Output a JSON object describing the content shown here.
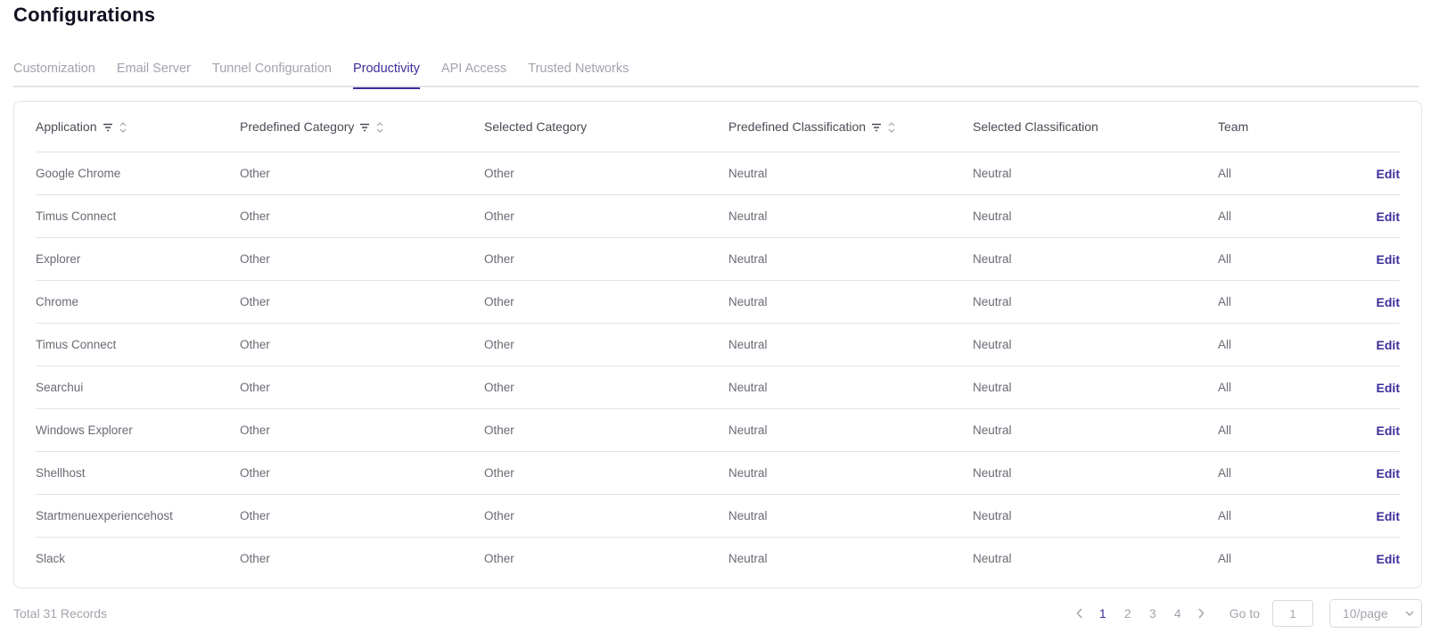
{
  "page_title": "Configurations",
  "tabs": [
    {
      "label": "Customization",
      "active": false
    },
    {
      "label": "Email Server",
      "active": false
    },
    {
      "label": "Tunnel Configuration",
      "active": false
    },
    {
      "label": "Productivity",
      "active": true
    },
    {
      "label": "API Access",
      "active": false
    },
    {
      "label": "Trusted Networks",
      "active": false
    }
  ],
  "table": {
    "columns": [
      {
        "label": "Application",
        "filter": true,
        "sort": true
      },
      {
        "label": "Predefined Category",
        "filter": true,
        "sort": true
      },
      {
        "label": "Selected Category",
        "filter": false,
        "sort": false
      },
      {
        "label": "Predefined Classification",
        "filter": true,
        "sort": true
      },
      {
        "label": "Selected Classification",
        "filter": false,
        "sort": false
      },
      {
        "label": "Team",
        "filter": false,
        "sort": false
      }
    ],
    "action_label": "Edit",
    "rows": [
      [
        "Google Chrome",
        "Other",
        "Other",
        "Neutral",
        "Neutral",
        "All"
      ],
      [
        "Timus Connect",
        "Other",
        "Other",
        "Neutral",
        "Neutral",
        "All"
      ],
      [
        "Explorer",
        "Other",
        "Other",
        "Neutral",
        "Neutral",
        "All"
      ],
      [
        "Chrome",
        "Other",
        "Other",
        "Neutral",
        "Neutral",
        "All"
      ],
      [
        "Timus Connect",
        "Other",
        "Other",
        "Neutral",
        "Neutral",
        "All"
      ],
      [
        "Searchui",
        "Other",
        "Other",
        "Neutral",
        "Neutral",
        "All"
      ],
      [
        "Windows Explorer",
        "Other",
        "Other",
        "Neutral",
        "Neutral",
        "All"
      ],
      [
        "Shellhost",
        "Other",
        "Other",
        "Neutral",
        "Neutral",
        "All"
      ],
      [
        "Startmenuexperiencehost",
        "Other",
        "Other",
        "Neutral",
        "Neutral",
        "All"
      ],
      [
        "Slack",
        "Other",
        "Other",
        "Neutral",
        "Neutral",
        "All"
      ]
    ]
  },
  "footer": {
    "total_text": "Total 31 Records",
    "pages": [
      "1",
      "2",
      "3",
      "4"
    ],
    "current_page": "1",
    "goto_label": "Go to",
    "goto_value": "1",
    "page_size": "10/page"
  },
  "colors": {
    "accent": "#3c2e9a",
    "border": "#e3e3e8",
    "muted": "#a3a3ad"
  },
  "icons": {
    "filter": "filter-icon",
    "sort": "sort-icon",
    "prev": "chevron-left-icon",
    "next": "chevron-right-icon",
    "dropdown": "chevron-down-icon"
  }
}
